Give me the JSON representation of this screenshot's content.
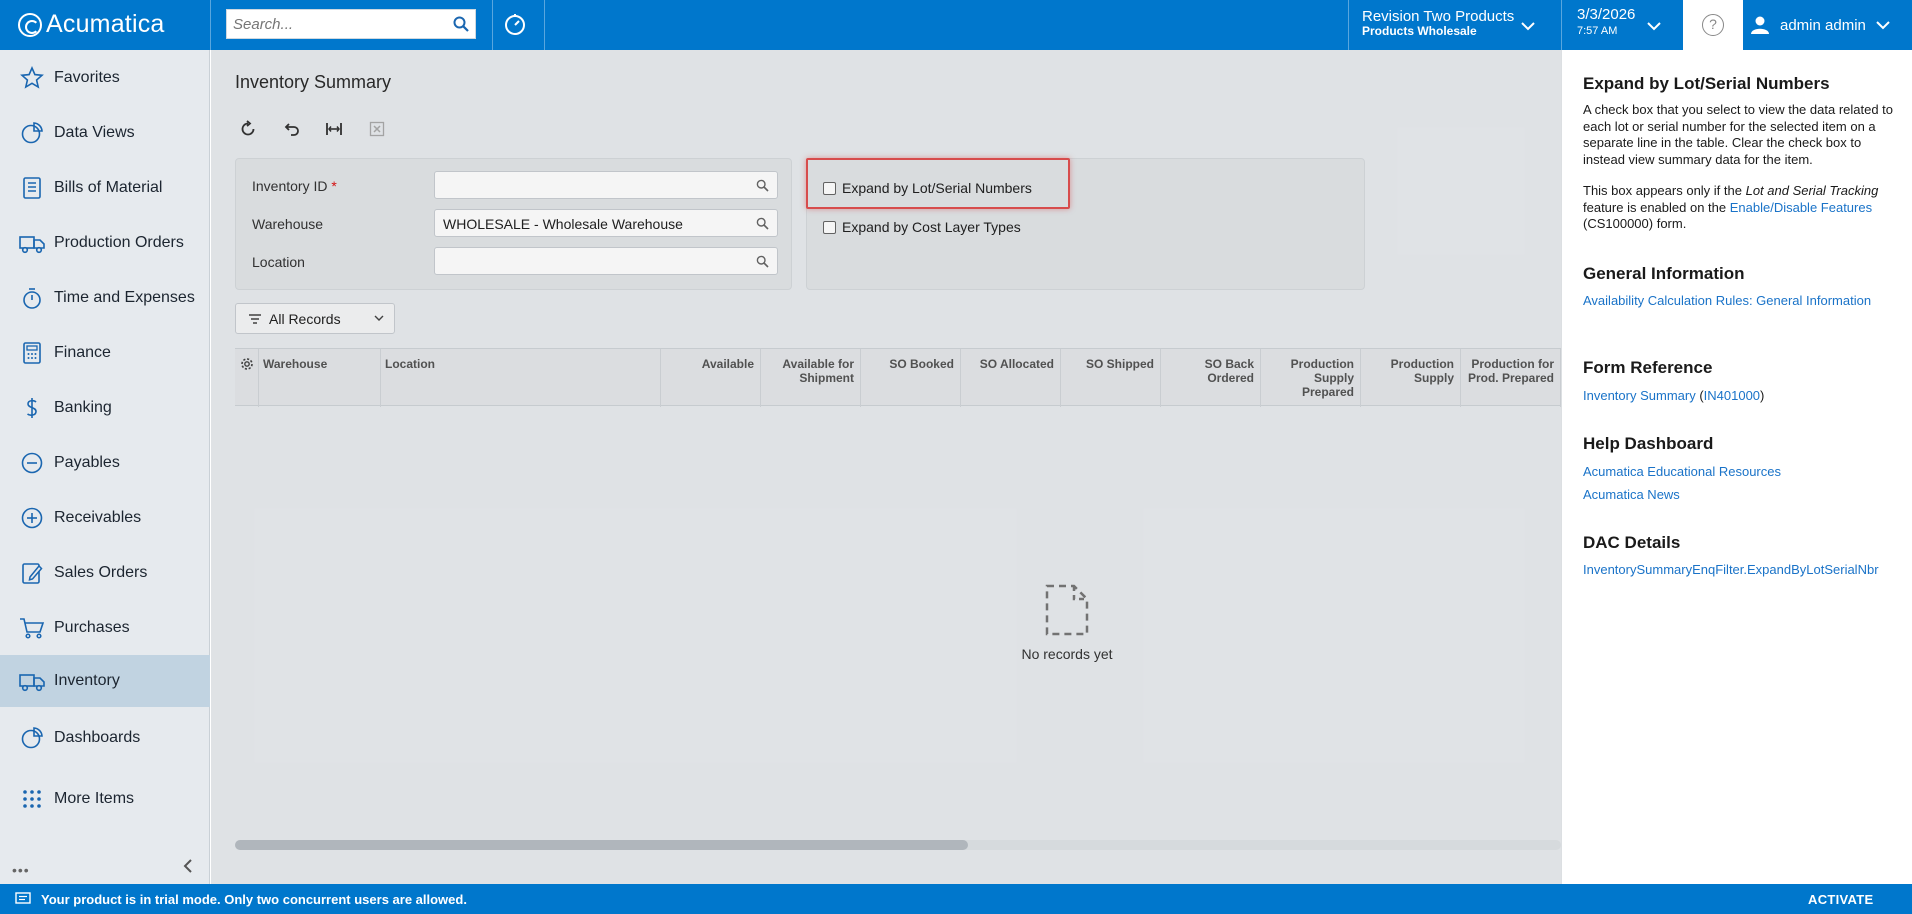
{
  "topbar": {
    "brand": "Acumatica",
    "search_placeholder": "Search...",
    "tenant_name": "Revision Two Products",
    "tenant_branch": "Products Wholesale",
    "date": "3/3/2026",
    "time": "7:57 AM",
    "user_name": "admin admin"
  },
  "sidebar": {
    "items": [
      {
        "label": "Favorites",
        "icon": "star-icon"
      },
      {
        "label": "Data Views",
        "icon": "pie-chart-icon"
      },
      {
        "label": "Bills of Material",
        "icon": "document-list-icon"
      },
      {
        "label": "Production Orders",
        "icon": "truck-icon"
      },
      {
        "label": "Time and Expenses",
        "icon": "stopwatch-icon"
      },
      {
        "label": "Finance",
        "icon": "calculator-icon"
      },
      {
        "label": "Banking",
        "icon": "dollar-icon"
      },
      {
        "label": "Payables",
        "icon": "minus-circle-icon"
      },
      {
        "label": "Receivables",
        "icon": "plus-circle-icon"
      },
      {
        "label": "Sales Orders",
        "icon": "edit-document-icon"
      },
      {
        "label": "Purchases",
        "icon": "cart-icon"
      },
      {
        "label": "Inventory",
        "icon": "truck-icon"
      },
      {
        "label": "Dashboards",
        "icon": "pie-chart-icon"
      },
      {
        "label": "More Items",
        "icon": "grid-dots-icon"
      }
    ],
    "active": "Inventory"
  },
  "main": {
    "title": "Inventory Summary",
    "form": {
      "inventory_id_label": "Inventory ID",
      "inventory_id_required": "*",
      "inventory_id_value": "",
      "warehouse_label": "Warehouse",
      "warehouse_value": "WHOLESALE - Wholesale Warehouse",
      "location_label": "Location",
      "location_value": "",
      "expand_lot_serial_label": "Expand by Lot/Serial Numbers",
      "expand_lot_serial_checked": false,
      "expand_cost_layer_label": "Expand by Cost Layer Types",
      "expand_cost_layer_checked": false
    },
    "filter": {
      "label": "All Records"
    },
    "grid": {
      "columns": [
        "Warehouse",
        "Location",
        "Available",
        "Available for Shipment",
        "SO Booked",
        "SO Allocated",
        "SO Shipped",
        "SO Back Ordered",
        "Production Supply Prepared",
        "Production Supply",
        "Production for Prod. Prepared"
      ],
      "rows": [],
      "empty_text": "No records yet"
    }
  },
  "help": {
    "title": "Expand by Lot/Serial Numbers",
    "desc_1": "A check box that you select to view the data related to each lot or serial number for the selected item on a separate line in the table. Clear the check box to instead view summary data for the item.",
    "desc_2_prefix": "This box appears only if the ",
    "desc_2_italic": "Lot and Serial Tracking",
    "desc_2_mid": " feature is enabled on the ",
    "desc_2_link": "Enable/Disable Features",
    "desc_2_suffix": " (CS100000) form.",
    "general_info_heading": "General Information",
    "general_info_link": "Availability Calculation Rules: General Information",
    "form_ref_heading": "Form Reference",
    "form_ref_link": "Inventory Summary",
    "form_ref_open": " (",
    "form_ref_code": "IN401000",
    "form_ref_close": ")",
    "dashboard_heading": "Help Dashboard",
    "dashboard_link_1": "Acumatica Educational Resources",
    "dashboard_link_2": "Acumatica News",
    "dac_heading": "DAC Details",
    "dac_link": "InventorySummaryEnqFilter.ExpandByLotSerialNbr"
  },
  "bottombar": {
    "message": "Your product is in trial mode. Only two concurrent users are allowed.",
    "activate_label": "ACTIVATE"
  },
  "colors": {
    "brand_blue": "#0077cc",
    "sidebar_bg": "#e6eaee",
    "sidebar_active": "#c1d3e1",
    "link": "#1a73c8",
    "highlight_red": "#e05050"
  }
}
